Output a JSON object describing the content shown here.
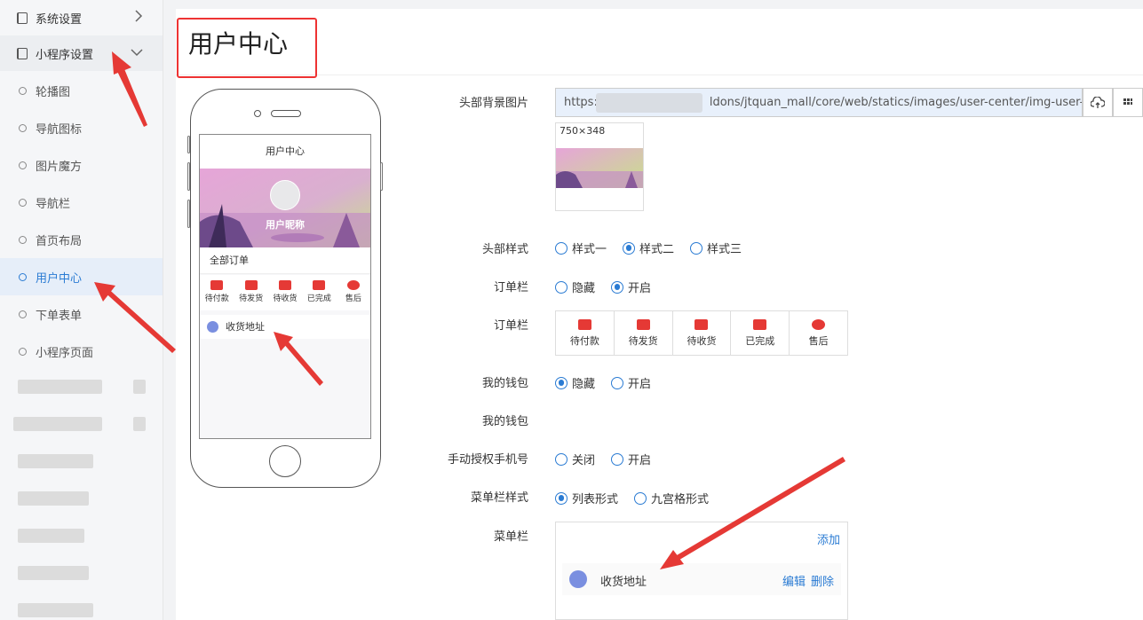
{
  "sidebar": {
    "system_settings": "系统设置",
    "mini_settings": "小程序设置",
    "items": [
      {
        "label": "轮播图"
      },
      {
        "label": "导航图标"
      },
      {
        "label": "图片魔方"
      },
      {
        "label": "导航栏"
      },
      {
        "label": "首页布局"
      },
      {
        "label": "用户中心"
      },
      {
        "label": "下单表单"
      },
      {
        "label": "小程序页面"
      }
    ]
  },
  "page_title": "用户中心",
  "phone": {
    "title": "用户中心",
    "nickname": "用户昵称",
    "all_orders": "全部订单",
    "orders": [
      "待付款",
      "待发货",
      "待收货",
      "已完成",
      "售后"
    ],
    "address": "收货地址"
  },
  "form": {
    "header_bg_label": "头部背景图片",
    "header_bg_url": "https:",
    "header_bg_url_tail": "ldons/jtquan_mall/core/web/statics/images/user-center/img-user-bg.",
    "thumb_dim": "750×348",
    "header_style_label": "头部样式",
    "header_styles": [
      "样式一",
      "样式二",
      "样式三"
    ],
    "order_bar_label": "订单栏",
    "order_bar_opts": [
      "隐藏",
      "开启"
    ],
    "order_bar2_label": "订单栏",
    "order_items": [
      "待付款",
      "待发货",
      "待收货",
      "已完成",
      "售后"
    ],
    "wallet_label": "我的钱包",
    "wallet_opts": [
      "隐藏",
      "开启"
    ],
    "wallet2_label": "我的钱包",
    "phone_auth_label": "手动授权手机号",
    "phone_auth_opts": [
      "关闭",
      "开启"
    ],
    "menu_style_label": "菜单栏样式",
    "menu_style_opts": [
      "列表形式",
      "九宫格形式"
    ],
    "menu_label": "菜单栏",
    "menu_add": "添加",
    "menu_item_name": "收货地址",
    "menu_edit": "编辑",
    "menu_delete": "删除"
  },
  "selected": {
    "header_style": "样式二",
    "order_bar": "开启",
    "wallet": "隐藏",
    "phone_auth": "none",
    "menu_style": "列表形式"
  },
  "colors": {
    "accent": "#2a7bd3",
    "annotation": "#e53935"
  }
}
